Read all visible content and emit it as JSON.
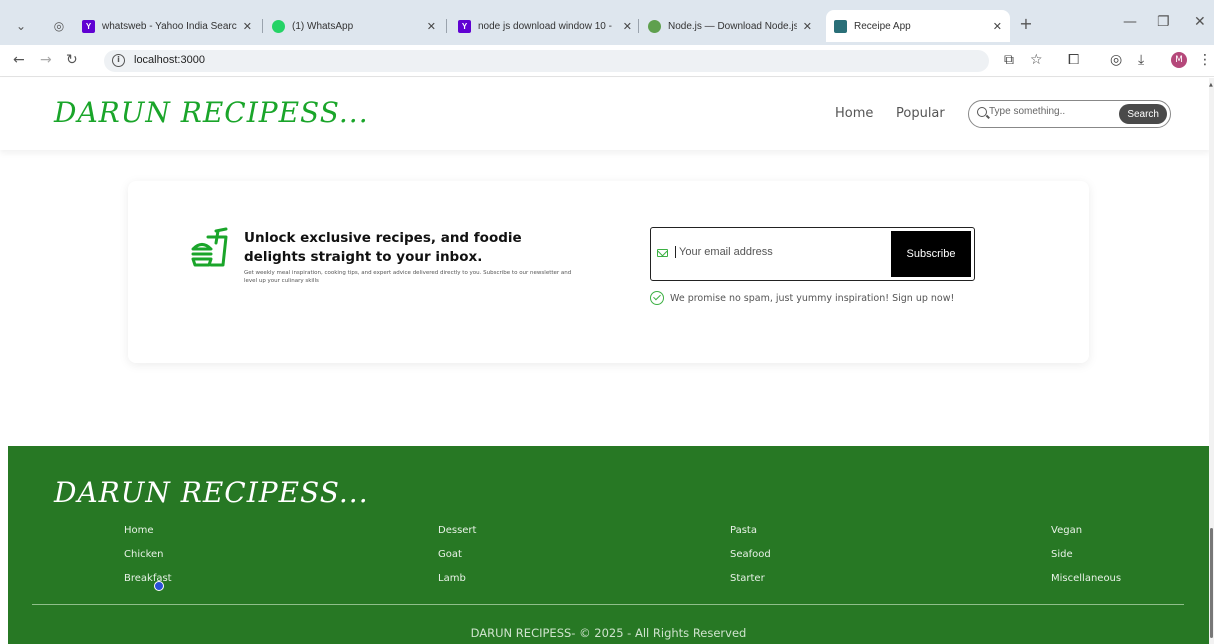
{
  "browser": {
    "tabs": [
      {
        "title": "whatsweb - Yahoo India Search",
        "favicon": "yahoo-icon",
        "color": "#6001d2"
      },
      {
        "title": "(1) WhatsApp",
        "favicon": "whatsapp-icon",
        "color": "#25d366"
      },
      {
        "title": "node js download window 10 -",
        "favicon": "yahoo-icon",
        "color": "#6001d2"
      },
      {
        "title": "Node.js — Download Node.js®",
        "favicon": "nodejs-icon",
        "color": "#5fa04e"
      },
      {
        "title": "Receipe App",
        "favicon": "app-icon",
        "color": "#2a6f78"
      }
    ],
    "url": "localhost:3000",
    "profile_initial": "M"
  },
  "header": {
    "logo": "DARUN RECIPESS...",
    "nav": {
      "home": "Home",
      "popular": "Popular"
    },
    "search": {
      "placeholder": "Type something..",
      "button": "Search"
    }
  },
  "newsletter": {
    "headline": "Unlock exclusive recipes, and foodie delights straight to your inbox.",
    "subtext": "Get weekly meal inspiration, cooking tips, and expert advice delivered directly to you. Subscribe to our newsletter and level up your culinary skills",
    "email_placeholder": "Your email address",
    "subscribe_label": "Subscribe",
    "promise": "We promise no spam, just yummy inspiration! Sign up now!"
  },
  "footer": {
    "logo": "DARUN RECIPESS...",
    "columns": [
      [
        "Home",
        "Chicken",
        "Breakfast"
      ],
      [
        "Dessert",
        "Goat",
        "Lamb"
      ],
      [
        "Pasta",
        "Seafood",
        "Starter"
      ],
      [
        "Vegan",
        "Side",
        "Miscellaneous"
      ]
    ],
    "copyright": "DARUN RECIPESS- © 2025 - All Rights Reserved"
  },
  "colors": {
    "brand_green": "#1aa52a",
    "footer_green": "#277824",
    "accent_check": "#3cb043"
  }
}
